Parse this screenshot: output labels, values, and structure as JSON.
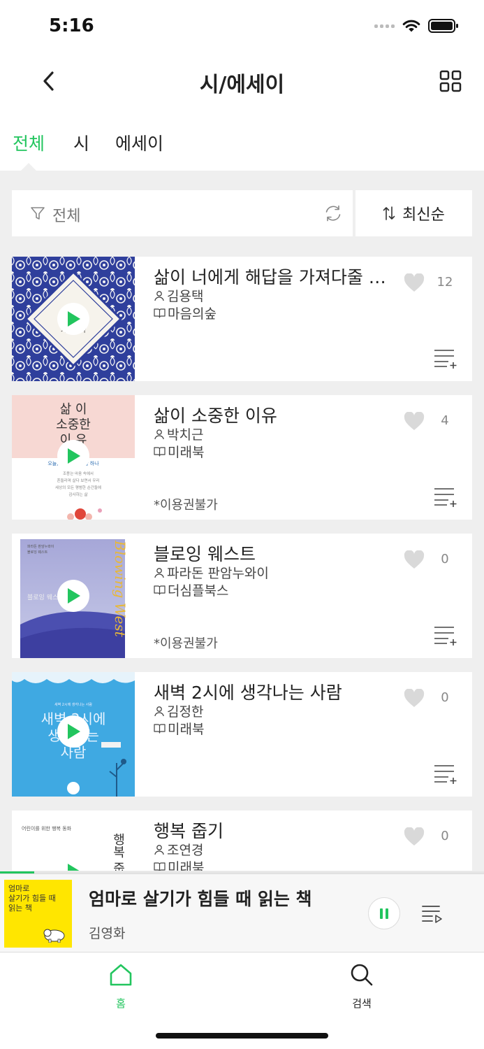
{
  "status": {
    "time": "5:16"
  },
  "header": {
    "title": "시/에세이"
  },
  "tabs": [
    {
      "label": "전체",
      "active": true
    },
    {
      "label": "시",
      "active": false
    },
    {
      "label": "에세이",
      "active": false
    }
  ],
  "filter": {
    "label": "전체",
    "sort_label": "최신순"
  },
  "items": [
    {
      "title": "삶이 너에게 해답을 가져다줄 거야",
      "author": "김용택",
      "publisher": "마음의숲",
      "note": "",
      "likes": "12"
    },
    {
      "title": "삶이 소중한 이유",
      "author": "박치근",
      "publisher": "미래북",
      "note": "*이용권불가",
      "likes": "4"
    },
    {
      "title": "블로잉 웨스트",
      "author": "파라돈 판암누와이",
      "publisher": "더심플북스",
      "note": "*이용권불가",
      "likes": "0"
    },
    {
      "title": "새벽 2시에 생각나는 사람",
      "author": "김정한",
      "publisher": "미래북",
      "note": "",
      "likes": "0"
    },
    {
      "title": "행복 줍기",
      "author": "조연경",
      "publisher": "미래북",
      "note": "",
      "likes": "0"
    }
  ],
  "covers": {
    "item1": "가져다 다",
    "item2_title": [
      "삶 이",
      "소중한",
      "이 유"
    ],
    "item2_band": "오늘, 마음이 고요할 하나",
    "item2_lines": [
      "조용한 마음 속에서",
      "흔들리며 살다 보면서 우리",
      "세상의 모든 평범한 순간들에",
      "감사하는 삶"
    ],
    "item3_small": [
      "파라돈 판암누와이",
      "블로잉 웨스트"
    ],
    "item3_mid": "블로잉 웨스트",
    "item3_script": "Blowing West",
    "item4_small": "새벽 2시에 생각나는 사람",
    "item4_big": [
      "새벽 2시에",
      "생각나는",
      "사람"
    ],
    "item5_small": "어린이를 위한 행복 동화",
    "item5_vertical": "행복 줍",
    "player": "엄마로\n살기가 힘들 때\n읽는 책"
  },
  "player": {
    "title": "엄마로 살기가 힘들 때 읽는 책",
    "author": "김영화",
    "progress": 0.07
  },
  "nav": [
    {
      "label": "홈",
      "active": true
    },
    {
      "label": "검색",
      "active": false
    }
  ],
  "colors": {
    "accent": "#22c55e",
    "background": "#efefef"
  }
}
